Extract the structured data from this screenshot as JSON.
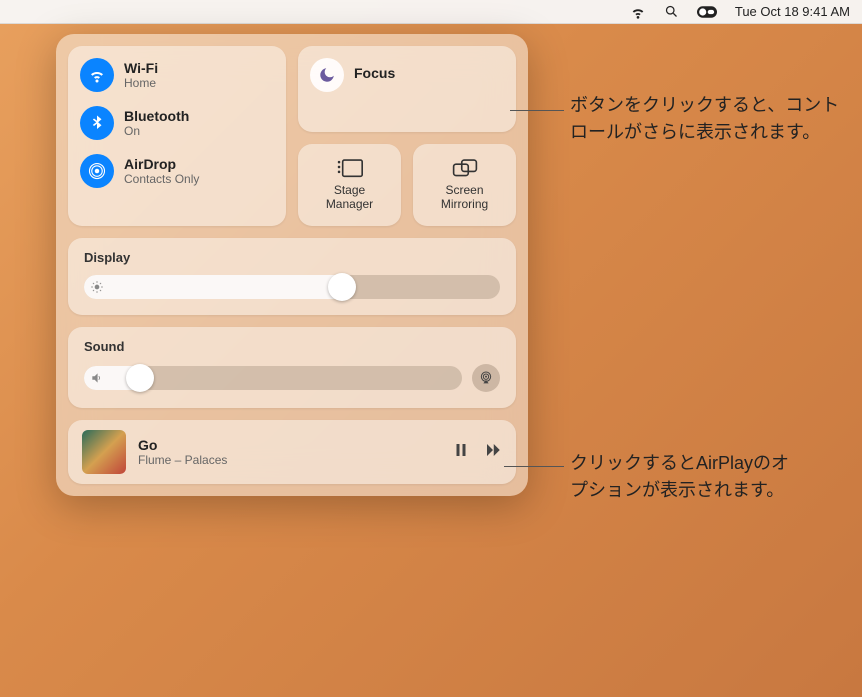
{
  "menubar": {
    "date_time": "Tue Oct 18  9:41 AM"
  },
  "connectivity": {
    "wifi": {
      "label": "Wi-Fi",
      "status": "Home"
    },
    "bluetooth": {
      "label": "Bluetooth",
      "status": "On"
    },
    "airdrop": {
      "label": "AirDrop",
      "status": "Contacts Only"
    }
  },
  "focus": {
    "label": "Focus"
  },
  "stage_manager": {
    "label": "Stage\nManager"
  },
  "screen_mirroring": {
    "label": "Screen\nMirroring"
  },
  "display": {
    "title": "Display",
    "value_pct": 65
  },
  "sound": {
    "title": "Sound",
    "value_pct": 18
  },
  "now_playing": {
    "track": "Go",
    "artist_album": "Flume – Palaces"
  },
  "callouts": {
    "focus": "ボタンをクリックすると、コントロールがさらに表示されます。",
    "airplay": "クリックするとAirPlayのオプションが表示されます。"
  }
}
